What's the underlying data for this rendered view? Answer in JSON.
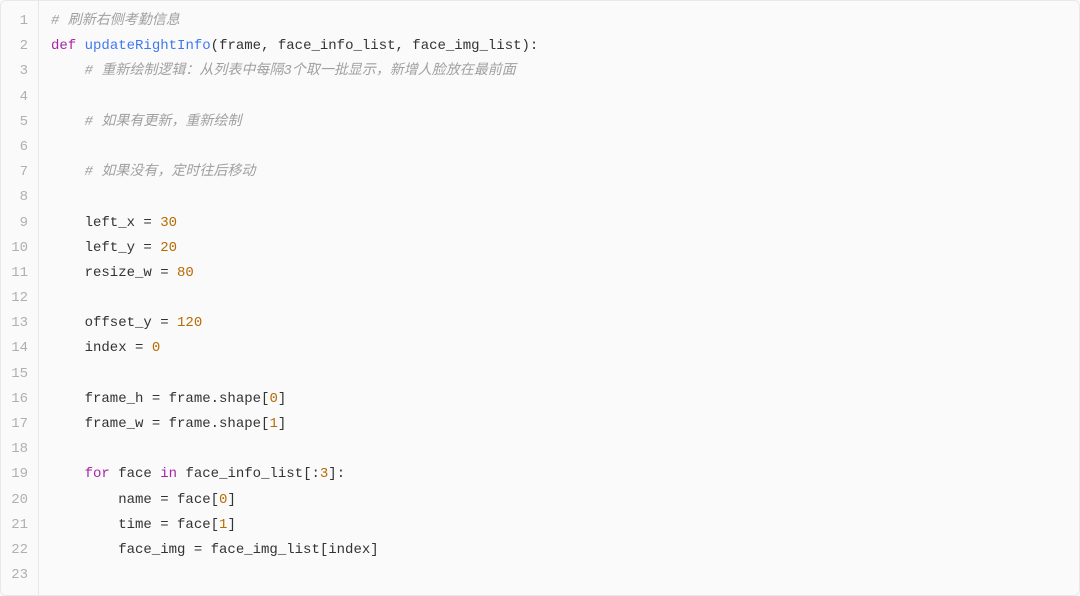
{
  "code": {
    "lines": [
      {
        "num": "1",
        "tokens": [
          {
            "cls": "tok-comment",
            "text": "# 刷新右侧考勤信息"
          }
        ]
      },
      {
        "num": "2",
        "tokens": [
          {
            "cls": "tok-keyword",
            "text": "def"
          },
          {
            "cls": "tok-text",
            "text": " "
          },
          {
            "cls": "tok-function",
            "text": "updateRightInfo"
          },
          {
            "cls": "tok-punct",
            "text": "("
          },
          {
            "cls": "tok-param",
            "text": "frame, face_info_list, face_img_list"
          },
          {
            "cls": "tok-punct",
            "text": "):"
          }
        ]
      },
      {
        "num": "3",
        "tokens": [
          {
            "cls": "tok-text",
            "text": "    "
          },
          {
            "cls": "tok-comment",
            "text": "# 重新绘制逻辑：从列表中每隔3个取一批显示，新增人脸放在最前面"
          }
        ]
      },
      {
        "num": "4",
        "tokens": []
      },
      {
        "num": "5",
        "tokens": [
          {
            "cls": "tok-text",
            "text": "    "
          },
          {
            "cls": "tok-comment",
            "text": "# 如果有更新，重新绘制"
          }
        ]
      },
      {
        "num": "6",
        "tokens": []
      },
      {
        "num": "7",
        "tokens": [
          {
            "cls": "tok-text",
            "text": "    "
          },
          {
            "cls": "tok-comment",
            "text": "# 如果没有，定时往后移动"
          }
        ]
      },
      {
        "num": "8",
        "tokens": []
      },
      {
        "num": "9",
        "tokens": [
          {
            "cls": "tok-text",
            "text": "    left_x = "
          },
          {
            "cls": "tok-number",
            "text": "30"
          }
        ]
      },
      {
        "num": "10",
        "tokens": [
          {
            "cls": "tok-text",
            "text": "    left_y = "
          },
          {
            "cls": "tok-number",
            "text": "20"
          }
        ]
      },
      {
        "num": "11",
        "tokens": [
          {
            "cls": "tok-text",
            "text": "    resize_w = "
          },
          {
            "cls": "tok-number",
            "text": "80"
          }
        ]
      },
      {
        "num": "12",
        "tokens": []
      },
      {
        "num": "13",
        "tokens": [
          {
            "cls": "tok-text",
            "text": "    offset_y = "
          },
          {
            "cls": "tok-number",
            "text": "120"
          }
        ]
      },
      {
        "num": "14",
        "tokens": [
          {
            "cls": "tok-text",
            "text": "    index = "
          },
          {
            "cls": "tok-number",
            "text": "0"
          }
        ]
      },
      {
        "num": "15",
        "tokens": []
      },
      {
        "num": "16",
        "tokens": [
          {
            "cls": "tok-text",
            "text": "    frame_h = frame.shape["
          },
          {
            "cls": "tok-number",
            "text": "0"
          },
          {
            "cls": "tok-text",
            "text": "]"
          }
        ]
      },
      {
        "num": "17",
        "tokens": [
          {
            "cls": "tok-text",
            "text": "    frame_w = frame.shape["
          },
          {
            "cls": "tok-number",
            "text": "1"
          },
          {
            "cls": "tok-text",
            "text": "]"
          }
        ]
      },
      {
        "num": "18",
        "tokens": []
      },
      {
        "num": "19",
        "tokens": [
          {
            "cls": "tok-text",
            "text": "    "
          },
          {
            "cls": "tok-keyword",
            "text": "for"
          },
          {
            "cls": "tok-text",
            "text": " face "
          },
          {
            "cls": "tok-keyword",
            "text": "in"
          },
          {
            "cls": "tok-text",
            "text": " face_info_list[:"
          },
          {
            "cls": "tok-number",
            "text": "3"
          },
          {
            "cls": "tok-text",
            "text": "]:"
          }
        ]
      },
      {
        "num": "20",
        "tokens": [
          {
            "cls": "tok-text",
            "text": "        name = face["
          },
          {
            "cls": "tok-number",
            "text": "0"
          },
          {
            "cls": "tok-text",
            "text": "]"
          }
        ]
      },
      {
        "num": "21",
        "tokens": [
          {
            "cls": "tok-text",
            "text": "        time = face["
          },
          {
            "cls": "tok-number",
            "text": "1"
          },
          {
            "cls": "tok-text",
            "text": "]"
          }
        ]
      },
      {
        "num": "22",
        "tokens": [
          {
            "cls": "tok-text",
            "text": "        face_img = face_img_list[index]"
          }
        ]
      },
      {
        "num": "23",
        "tokens": []
      }
    ]
  }
}
